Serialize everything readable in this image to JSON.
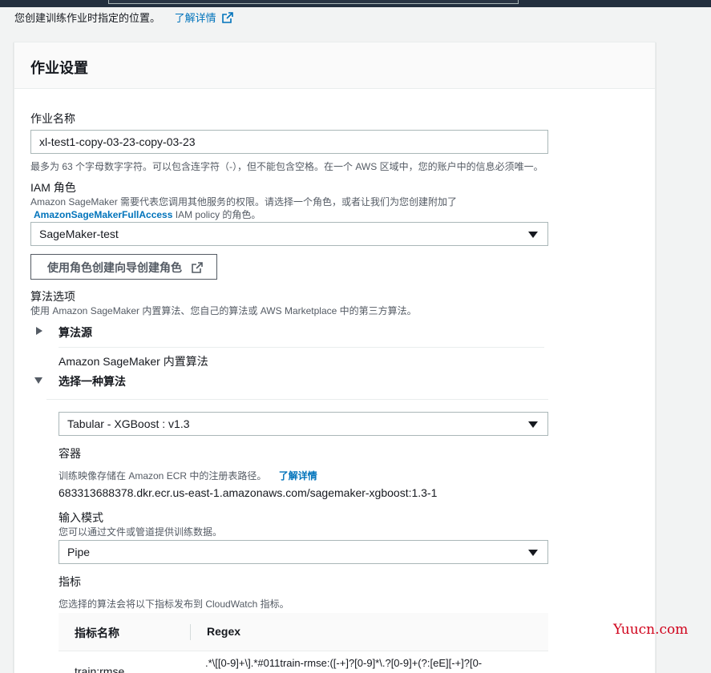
{
  "intro": {
    "text": "您创建训练作业时指定的位置。",
    "learn_more": "了解详情"
  },
  "panel": {
    "title": "作业设置"
  },
  "job_name": {
    "label": "作业名称",
    "value": "xl-test1-copy-03-23-copy-03-23",
    "hint": "最多为 63 个字母数字字符。可以包含连字符（-），但不能包含空格。在一个 AWS 区域中，您的账户中的信息必须唯一。"
  },
  "iam_role": {
    "label": "IAM 角色",
    "desc_line1": "Amazon SageMaker 需要代表您调用其他服务的权限。请选择一个角色，或者让我们为您创建附加了",
    "policy_name": "AmazonSageMakerFullAccess",
    "desc_line2": " IAM policy 的角色。",
    "selected": "SageMaker-test",
    "create_button": "使用角色创建向导创建角色"
  },
  "algorithm": {
    "label": "算法选项",
    "desc": "使用 Amazon SageMaker 内置算法、您自己的算法或 AWS Marketplace 中的第三方算法。",
    "source_label": "算法源",
    "source_value": "Amazon SageMaker 内置算法",
    "choose_label": "选择一种算法",
    "selected": "Tabular - XGBoost : v1.3"
  },
  "container": {
    "label": "容器",
    "desc": "训练映像存储在 Amazon ECR 中的注册表路径。",
    "learn_more": "了解详情",
    "path": "683313688378.dkr.ecr.us-east-1.amazonaws.com/sagemaker-xgboost:1.3-1"
  },
  "input_mode": {
    "label": "输入模式",
    "desc": "您可以通过文件或管道提供训练数据。",
    "selected": "Pipe"
  },
  "metrics": {
    "label": "指标",
    "desc": "您选择的算法会将以下指标发布到 CloudWatch 指标。",
    "columns": [
      "指标名称",
      "Regex"
    ],
    "rows": [
      {
        "name": "train:rmse",
        "regex": ".*\\[[0-9]+\\].*#011train-rmse:([-+]?[0-9]*\\.?[0-9]+(?:[eE][-+]?[0-"
      }
    ]
  },
  "watermark": "Yuucn.com",
  "colors": {
    "link": "#0073bb",
    "topbar": "#232f3e",
    "watermark": "#d0021b"
  }
}
